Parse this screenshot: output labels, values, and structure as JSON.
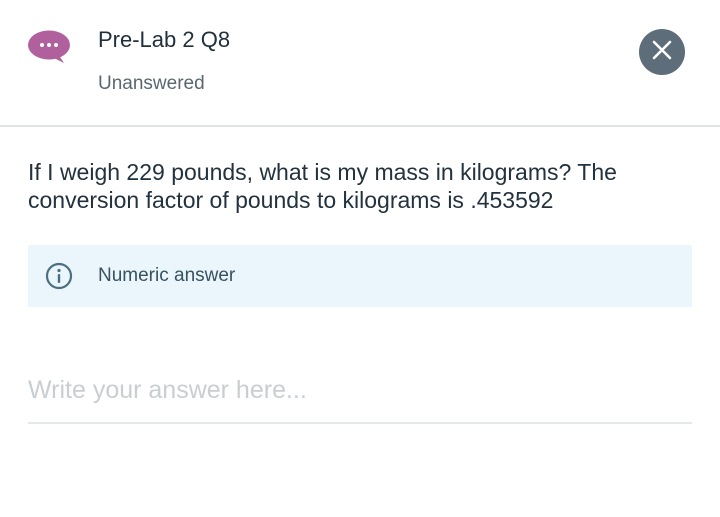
{
  "header": {
    "title": "Pre-Lab 2 Q8",
    "status": "Unanswered",
    "icon": "chat-bubble-icon",
    "close_icon": "close-icon"
  },
  "question": {
    "text": "If I weigh 229 pounds, what is my mass in kilograms? The conversion factor of pounds to kilograms is .453592"
  },
  "hint": {
    "icon": "info-icon",
    "text": "Numeric answer"
  },
  "answer": {
    "value": "",
    "placeholder": "Write your answer here..."
  },
  "colors": {
    "chat_icon": "#b0609c",
    "close_button": "#5d6d79",
    "hint_background": "#eaf5fc",
    "hint_accent": "#4b6f80"
  }
}
